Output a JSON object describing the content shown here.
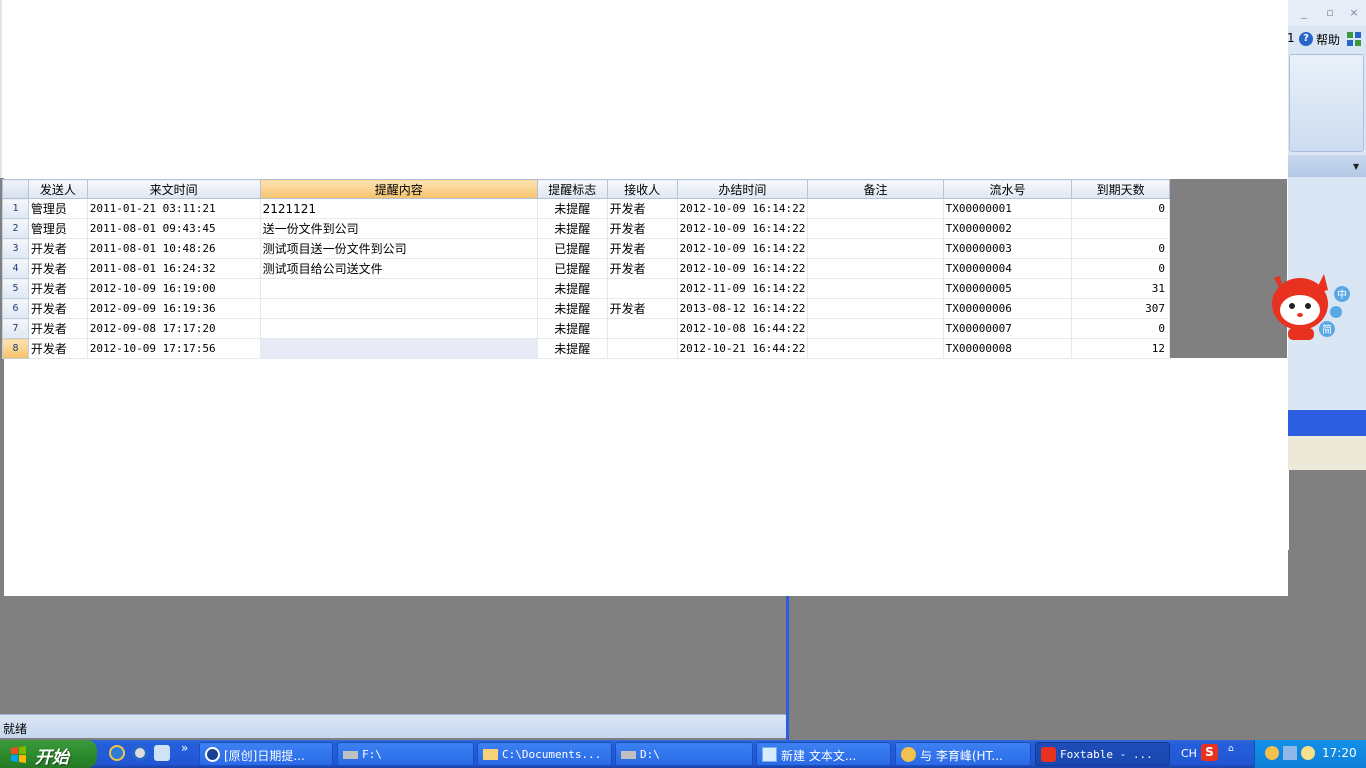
{
  "window": {
    "help_prefix": "1",
    "help_label": "帮助",
    "min_glyph": "_",
    "max_glyph": "▫",
    "close_glyph": "×"
  },
  "grid": {
    "columns": [
      "发送人",
      "来文时间",
      "提醒内容",
      "提醒标志",
      "接收人",
      "办结时间",
      "备注",
      "流水号",
      "到期天数"
    ],
    "selected_column": "提醒内容",
    "current_row": 8,
    "rows": [
      {
        "n": "1",
        "sender": "管理员",
        "time": "2011-01-21 03:11:21",
        "content": "2121121",
        "flag": "未提醒",
        "receiver": "开发者",
        "done": "2012-10-09 16:14:22",
        "note": "",
        "serial": "TX00000001",
        "days": "0"
      },
      {
        "n": "2",
        "sender": "管理员",
        "time": "2011-08-01 09:43:45",
        "content": "送一份文件到公司",
        "flag": "未提醒",
        "receiver": "开发者",
        "done": "2012-10-09 16:14:22",
        "note": "",
        "serial": "TX00000002",
        "days": ""
      },
      {
        "n": "3",
        "sender": "开发者",
        "time": "2011-08-01 10:48:26",
        "content": "测试项目送一份文件到公司",
        "flag": "已提醒",
        "receiver": "开发者",
        "done": "2012-10-09 16:14:22",
        "note": "",
        "serial": "TX00000003",
        "days": "0"
      },
      {
        "n": "4",
        "sender": "开发者",
        "time": "2011-08-01 16:24:32",
        "content": "测试项目给公司送文件",
        "flag": "已提醒",
        "receiver": "开发者",
        "done": "2012-10-09 16:14:22",
        "note": "",
        "serial": "TX00000004",
        "days": "0"
      },
      {
        "n": "5",
        "sender": "开发者",
        "time": "2012-10-09 16:19:00",
        "content": "",
        "flag": "未提醒",
        "receiver": "",
        "done": "2012-11-09 16:14:22",
        "note": "",
        "serial": "TX00000005",
        "days": "31"
      },
      {
        "n": "6",
        "sender": "开发者",
        "time": "2012-09-09 16:19:36",
        "content": "",
        "flag": "未提醒",
        "receiver": "开发者",
        "done": "2013-08-12 16:14:22",
        "note": "",
        "serial": "TX00000006",
        "days": "307"
      },
      {
        "n": "7",
        "sender": "开发者",
        "time": "2012-09-08 17:17:20",
        "content": "",
        "flag": "未提醒",
        "receiver": "",
        "done": "2012-10-08 16:44:22",
        "note": "",
        "serial": "TX00000007",
        "days": "0"
      },
      {
        "n": "8",
        "sender": "开发者",
        "time": "2012-10-09 17:17:56",
        "content": "",
        "flag": "未提醒",
        "receiver": "",
        "done": "2012-10-21 16:44:22",
        "note": "",
        "serial": "TX00000008",
        "days": "12"
      }
    ]
  },
  "status": {
    "text": "就绪"
  },
  "mascot": {
    "b1": "中",
    "b3": "简"
  },
  "taskbar": {
    "start_label": "开始",
    "overflow": "»",
    "tasks": [
      {
        "label": "[原创]日期提...",
        "icon": "sogou-browser-icon"
      },
      {
        "label": "F:\\",
        "icon": "drive-icon"
      },
      {
        "label": "C:\\Documents...",
        "icon": "folder-icon"
      },
      {
        "label": "D:\\",
        "icon": "drive-icon"
      },
      {
        "label": "新建 文本文...",
        "icon": "notepad-icon"
      },
      {
        "label": "与 李育峰(HT...",
        "icon": "chat-icon"
      },
      {
        "label": "Foxtable - ...",
        "icon": "foxtable-icon"
      }
    ],
    "lang": "CH",
    "ime": "S",
    "clock": "17:20"
  },
  "colors": {
    "accent": "#2b5fe0",
    "selected_header": "#f6c26c",
    "start_green": "#2f8f2f"
  }
}
